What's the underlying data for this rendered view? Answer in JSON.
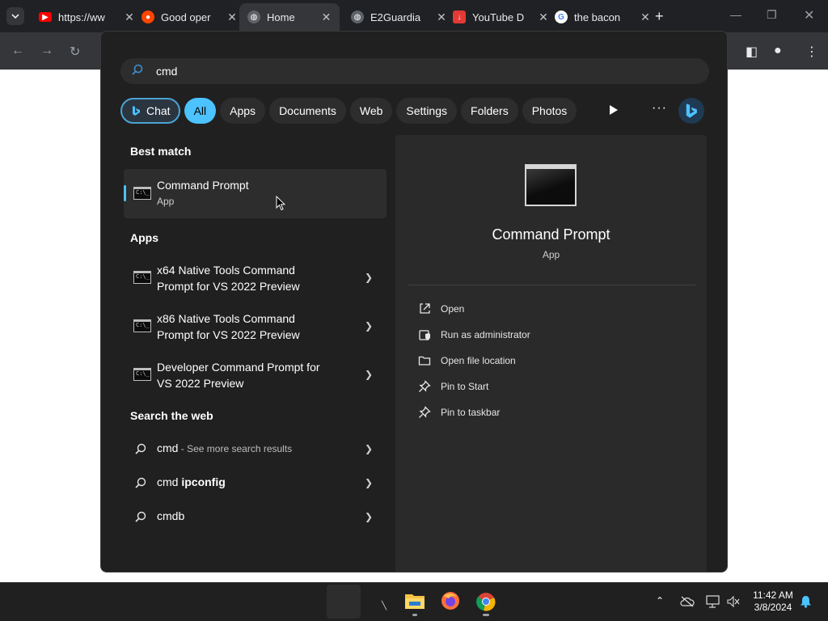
{
  "browser": {
    "tabs": [
      {
        "title": "https://ww",
        "icon": "youtube-icon",
        "color": "#ff0000",
        "active": false
      },
      {
        "title": "Good oper",
        "icon": "reddit-icon",
        "color": "#ff4500",
        "active": false
      },
      {
        "title": "Home",
        "icon": "globe-icon",
        "color": "#9aa0a6",
        "active": true
      },
      {
        "title": "E2Guardia",
        "icon": "globe-icon",
        "color": "#9aa0a6",
        "active": false
      },
      {
        "title": "YouTube D",
        "icon": "download-icon",
        "color": "#e53935",
        "active": false
      },
      {
        "title": "the bacon",
        "icon": "google-icon",
        "color": "#4285f4",
        "active": false
      }
    ]
  },
  "search": {
    "query": "cmd",
    "filters": [
      "Chat",
      "All",
      "Apps",
      "Documents",
      "Web",
      "Settings",
      "Folders",
      "Photos"
    ]
  },
  "best_match": {
    "heading": "Best match",
    "title": "Command Prompt",
    "sub": "App"
  },
  "apps": {
    "heading": "Apps",
    "items": [
      {
        "line1": "x64 Native Tools Command",
        "line2": "Prompt for VS 2022 Preview"
      },
      {
        "line1": "x86 Native Tools Command",
        "line2": "Prompt for VS 2022 Preview"
      },
      {
        "line1": "Developer Command Prompt for",
        "line2": "VS 2022 Preview"
      }
    ]
  },
  "web": {
    "heading": "Search the web",
    "items": [
      {
        "main": "cmd",
        "suffix": " - See more search results",
        "bold": ""
      },
      {
        "main": "cmd ",
        "suffix": "",
        "bold": "ipconfig"
      },
      {
        "main": "cmdb",
        "suffix": "",
        "bold": ""
      }
    ]
  },
  "detail": {
    "title": "Command Prompt",
    "sub": "App",
    "actions": [
      "Open",
      "Run as administrator",
      "Open file location",
      "Pin to Start",
      "Pin to taskbar"
    ]
  },
  "clock": {
    "time": "11:42 AM",
    "date": "3/8/2024"
  },
  "colors": {
    "accent": "#4cc2ff",
    "panel": "#202020",
    "pane": "#2a2a2a"
  }
}
